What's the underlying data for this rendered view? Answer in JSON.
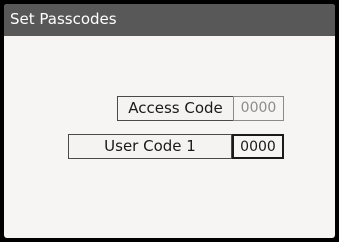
{
  "window": {
    "title": "Set Passcodes"
  },
  "fields": {
    "access_code": {
      "label": "Access Code",
      "value": "0000"
    },
    "user_code_1": {
      "label": "User Code 1",
      "value": "0000"
    }
  },
  "colors": {
    "title_bar": "#585858",
    "background": "#f6f5f3",
    "border_active": "#1a1a1a",
    "border_inactive": "#8a8a8a"
  }
}
